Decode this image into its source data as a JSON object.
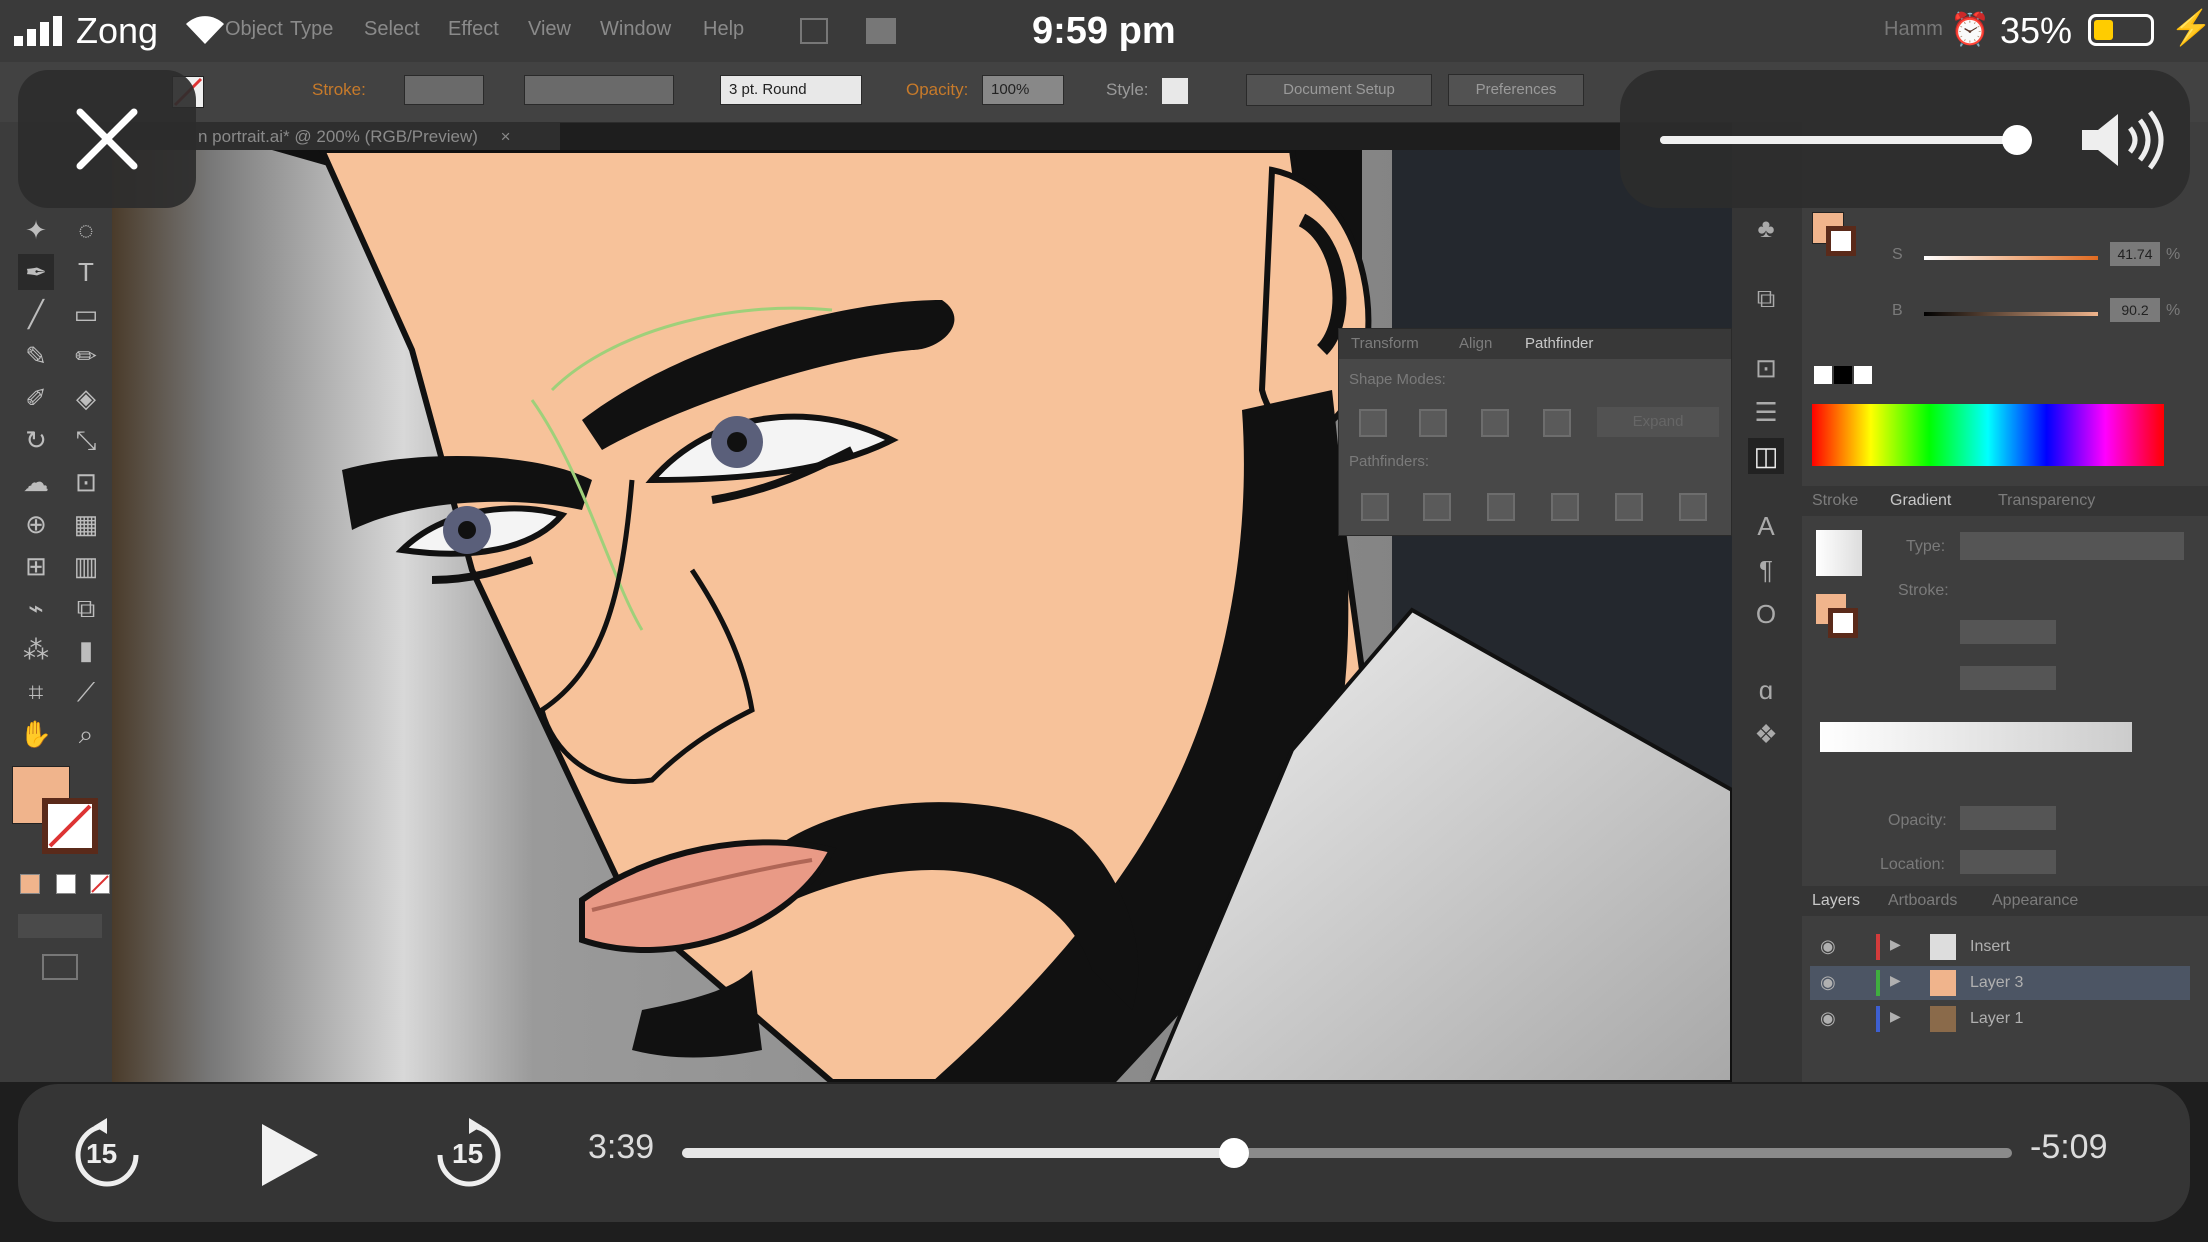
{
  "status_bar": {
    "carrier": "Zong",
    "time": "9:59 pm",
    "battery_percent": "35%",
    "battery_level": 0.35,
    "partial_label": "Hamm",
    "icons": [
      "signal-bars-icon",
      "wifi-icon",
      "alarm-icon",
      "battery-icon",
      "charging-bolt-icon"
    ]
  },
  "illustrator": {
    "menus": [
      "Object",
      "Type",
      "Select",
      "Effect",
      "View",
      "Window",
      "Help"
    ],
    "control_bar": {
      "stroke_label": "Stroke:",
      "brush_value": "3 pt. Round",
      "opacity_label": "Opacity:",
      "opacity_value": "100%",
      "style_label": "Style:",
      "document_setup": "Document Setup",
      "preferences": "Preferences"
    },
    "document_tab": "n portrait.ai* @ 200% (RGB/Preview)",
    "document_tab_close": "×",
    "colors": {
      "fill": "#f0b48c",
      "skin": "#f7c29a",
      "lips": "#e99a86",
      "panel_bg": "#3e3e3e",
      "accent_orange": "#c77a2a"
    },
    "color_panel": {
      "s_label": "S",
      "s_value": "41.74",
      "b_label": "B",
      "b_value": "90.2",
      "percent": "%"
    },
    "pathfinder_panel": {
      "tabs": [
        "Transform",
        "Align",
        "Pathfinder"
      ],
      "shape_modes_label": "Shape Modes:",
      "pathfinders_label": "Pathfinders:",
      "expand_button": "Expand"
    },
    "gradient_panel": {
      "tabs": [
        "Stroke",
        "Gradient",
        "Transparency"
      ],
      "type_label": "Type:",
      "stroke_label": "Stroke:",
      "opacity_label": "Opacity:",
      "location_label": "Location:"
    },
    "layers_panel": {
      "tabs": [
        "Layers",
        "Artboards",
        "Appearance"
      ],
      "layers": [
        {
          "name": "Insert",
          "color": "#d33b3b"
        },
        {
          "name": "Layer 3",
          "color": "#3fae3f"
        },
        {
          "name": "Layer 1",
          "color": "#3d5fd1"
        }
      ]
    }
  },
  "player": {
    "elapsed": "3:39",
    "remaining": "-5:09",
    "progress": 0.415,
    "skip_back_seconds": "15",
    "skip_forward_seconds": "15",
    "volume_level": 0.96
  }
}
